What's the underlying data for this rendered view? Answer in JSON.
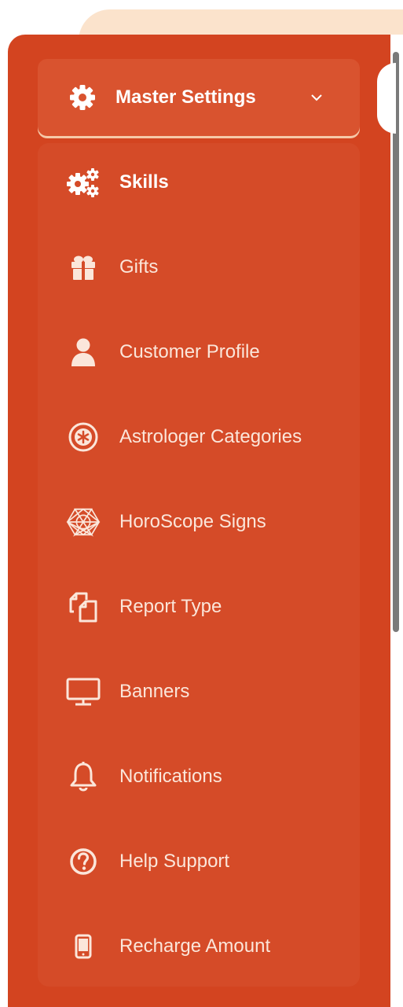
{
  "menu": {
    "title": "Master Settings",
    "items": [
      {
        "label": "Skills",
        "icon": "gears-icon",
        "active": true
      },
      {
        "label": "Gifts",
        "icon": "gift-icon"
      },
      {
        "label": "Customer Profile",
        "icon": "user-icon"
      },
      {
        "label": "Astrologer Categories",
        "icon": "asterisk-circle-icon"
      },
      {
        "label": "HoroScope Signs",
        "icon": "zodiac-icon"
      },
      {
        "label": "Report Type",
        "icon": "copy-files-icon"
      },
      {
        "label": "Banners",
        "icon": "monitor-icon"
      },
      {
        "label": "Notifications",
        "icon": "bell-icon"
      },
      {
        "label": "Help Support",
        "icon": "question-circle-icon"
      },
      {
        "label": "Recharge Amount",
        "icon": "mobile-phone-icon"
      }
    ]
  },
  "colors": {
    "sidebar": "#d34420",
    "submenu": "#d54b28",
    "header_bg": "#d9532f",
    "top_tab": "#fbe3cc",
    "text": "#ffffff"
  }
}
